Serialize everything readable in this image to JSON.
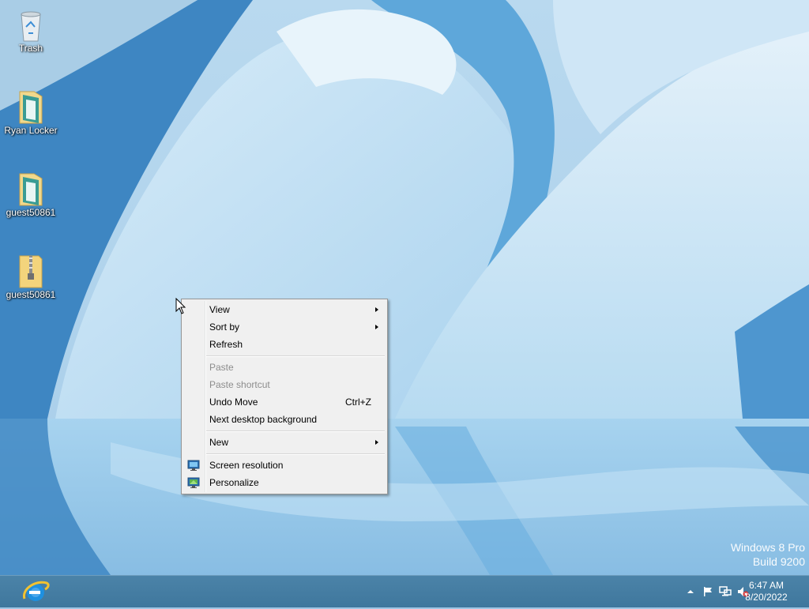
{
  "desktop": {
    "icons": [
      {
        "label": "Trash",
        "icon": "recycle-bin-icon"
      },
      {
        "label": "Ryan Locker",
        "icon": "folder-icon"
      },
      {
        "label": "guest50861",
        "icon": "folder-icon"
      },
      {
        "label": "guest50861",
        "icon": "zip-folder-icon"
      }
    ]
  },
  "context_menu": {
    "items": [
      {
        "label": "View",
        "submenu": true
      },
      {
        "label": "Sort by",
        "submenu": true
      },
      {
        "label": "Refresh"
      },
      {
        "label": "Paste",
        "disabled": true
      },
      {
        "label": "Paste shortcut",
        "disabled": true
      },
      {
        "label": "Undo Move",
        "shortcut": "Ctrl+Z"
      },
      {
        "label": "Next desktop background"
      },
      {
        "label": "New",
        "submenu": true
      },
      {
        "label": "Screen resolution",
        "icon": "monitor-icon"
      },
      {
        "label": "Personalize",
        "icon": "personalize-icon"
      }
    ]
  },
  "watermark": {
    "line1": "Windows 8 Pro",
    "line2": "Build 9200"
  },
  "taskbar": {
    "pinned": [
      {
        "icon": "internet-explorer-icon"
      }
    ],
    "tray_icons": [
      "show-hidden-icons-chevron",
      "action-center-flag-icon",
      "network-icon",
      "volume-muted-icon"
    ],
    "clock": {
      "time": "6:47 AM",
      "date": "8/20/2022"
    }
  },
  "colors": {
    "taskbar": "#3f779d",
    "menu_background": "#f0f0f0",
    "menu_disabled_text": "#8d8d8d"
  }
}
